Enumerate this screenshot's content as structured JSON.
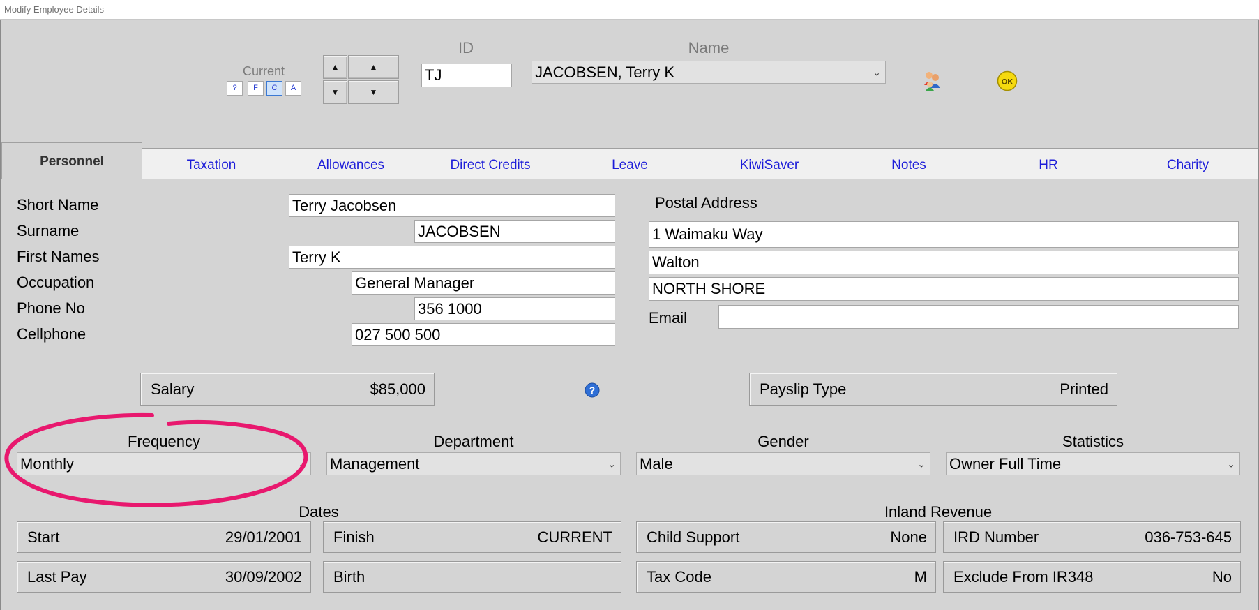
{
  "window": {
    "title": "Modify Employee Details"
  },
  "nav": {
    "current_label": "Current",
    "filter_buttons": [
      "?",
      "F",
      "C",
      "A"
    ],
    "selected_filter": "C",
    "id_label": "ID",
    "id_value": "TJ",
    "name_label": "Name",
    "name_value": "JACOBSEN, Terry K",
    "icons": [
      "employees-icon",
      "ok-icon"
    ],
    "ok_label": "OK"
  },
  "tabs": [
    "Personnel",
    "Taxation",
    "Allowances",
    "Direct Credits",
    "Leave",
    "KiwiSaver",
    "Notes",
    "HR",
    "Charity"
  ],
  "active_tab": "Personnel",
  "personnel": {
    "short_name": {
      "label": "Short Name",
      "value": "Terry Jacobsen"
    },
    "surname": {
      "label": "Surname",
      "value": "JACOBSEN"
    },
    "first_names": {
      "label": "First Names",
      "value": "Terry K"
    },
    "occupation": {
      "label": "Occupation",
      "value": "General Manager"
    },
    "phone": {
      "label": "Phone No",
      "value": "356 1000"
    },
    "cellphone": {
      "label": "Cellphone",
      "value": "027 500 500"
    },
    "postal": {
      "label": "Postal Address",
      "line1": "1 Waimaku Way",
      "line2": "Walton",
      "line3": "NORTH SHORE"
    },
    "email": {
      "label": "Email",
      "value": ""
    },
    "salary": {
      "label": "Salary",
      "value": "$85,000"
    },
    "payslip": {
      "label": "Payslip Type",
      "value": "Printed"
    },
    "frequency": {
      "label": "Frequency",
      "value": "Monthly"
    },
    "department": {
      "label": "Department",
      "value": "Management"
    },
    "gender": {
      "label": "Gender",
      "value": "Male"
    },
    "statistics": {
      "label": "Statistics",
      "value": "Owner Full Time"
    },
    "dates_label": "Dates",
    "start": {
      "label": "Start",
      "value": "29/01/2001"
    },
    "finish": {
      "label": "Finish",
      "value": "CURRENT"
    },
    "last_pay": {
      "label": "Last Pay",
      "value": "30/09/2002"
    },
    "birth": {
      "label": "Birth",
      "value": ""
    },
    "inland_revenue_label": "Inland Revenue",
    "child_support": {
      "label": "Child Support",
      "value": "None"
    },
    "ird_number": {
      "label": "IRD Number",
      "value": "036-753-645"
    },
    "tax_code": {
      "label": "Tax Code",
      "value": "M"
    },
    "exclude_ir348": {
      "label": "Exclude From IR348",
      "value": "No"
    }
  },
  "colors": {
    "background": "#d4d4d4",
    "tab_link": "#1d1dd9",
    "annotation": "#e8186e",
    "ok_icon": "#f5d90f"
  }
}
